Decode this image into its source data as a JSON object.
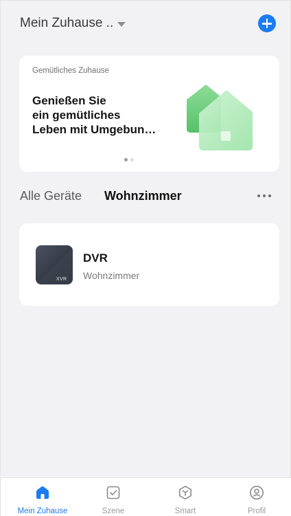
{
  "header": {
    "home_title": "Mein Zuhause ..",
    "add_icon": "plus-circle-icon",
    "accent_color": "#1c7cf2"
  },
  "banner": {
    "tag": "Gemütliches Zuhause",
    "headline_lines": [
      "Genießen Sie",
      "ein gemütliches",
      "Leben mit Umgebun…"
    ],
    "illustration": "green-houses-illustration",
    "page_indicator": {
      "pages": 2,
      "active": 1
    }
  },
  "room_tabs": {
    "all_label": "Alle Geräte",
    "selected_room": "Wohnzimmer",
    "more_icon": "more-dots-icon"
  },
  "devices": [
    {
      "name": "DVR",
      "room": "Wohnzimmer",
      "icon_text": "XVR"
    }
  ],
  "bottom_nav": {
    "items": [
      {
        "label": "Mein Zuhause",
        "icon": "home-icon",
        "active": true
      },
      {
        "label": "Szene",
        "icon": "checkbox-icon",
        "active": false
      },
      {
        "label": "Smart",
        "icon": "cube-icon",
        "active": false
      },
      {
        "label": "Profil",
        "icon": "profile-icon",
        "active": false
      }
    ]
  }
}
